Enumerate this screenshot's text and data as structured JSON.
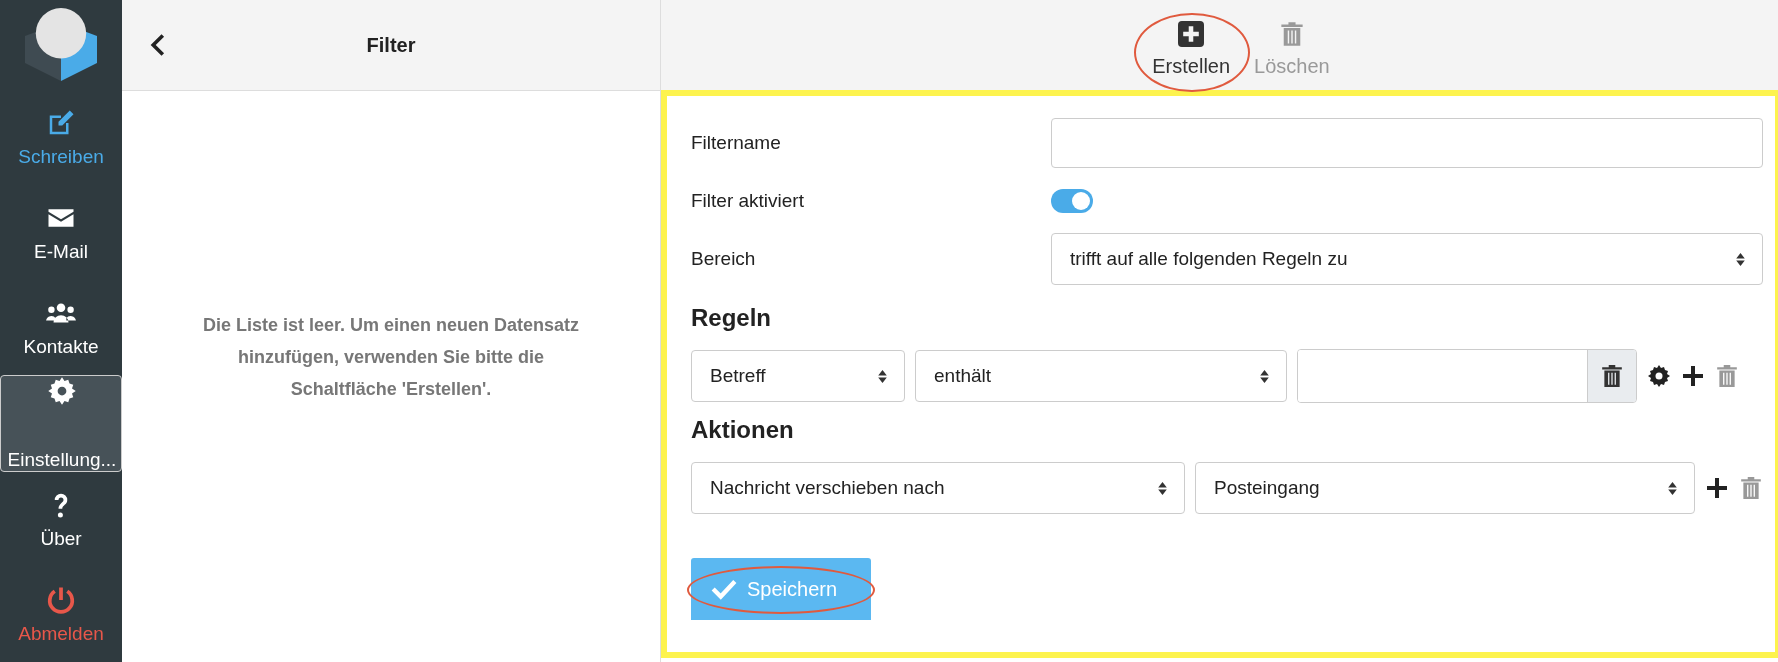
{
  "sidebar": {
    "items": [
      {
        "label": "Schreiben",
        "color": "#4aabe8",
        "selected": false
      },
      {
        "label": "E-Mail",
        "color": "#ffffff",
        "selected": false
      },
      {
        "label": "Kontakte",
        "color": "#ffffff",
        "selected": false
      },
      {
        "label": "Einstellung...",
        "color": "#ffffff",
        "selected": true
      },
      {
        "label": "Über",
        "color": "#ffffff",
        "selected": false
      },
      {
        "label": "Abmelden",
        "color": "#e8574a",
        "selected": false
      }
    ]
  },
  "list_panel": {
    "title": "Filter",
    "empty_message": "Die Liste ist leer. Um einen neuen Datensatz hinzufügen, verwenden Sie bitte die Schaltfläche 'Erstellen'."
  },
  "toolbar": {
    "buttons": [
      {
        "label": "Erstellen",
        "disabled": false,
        "annotated": true
      },
      {
        "label": "Löschen",
        "disabled": true,
        "annotated": false
      }
    ]
  },
  "form": {
    "highlighted": true,
    "name_label": "Filtername",
    "enabled_label": "Filter aktiviert",
    "enabled_on": true,
    "scope_label": "Bereich",
    "scope_value": "trifft auf alle folgenden Regeln zu",
    "rules_heading": "Regeln",
    "rules": [
      {
        "header": "Betreff",
        "operator": "enthält"
      }
    ],
    "actions_heading": "Aktionen",
    "actions": [
      {
        "type": "Nachricht verschieben nach",
        "target": "Posteingang"
      }
    ],
    "save": {
      "label": "Speichern",
      "annotated": true
    }
  }
}
